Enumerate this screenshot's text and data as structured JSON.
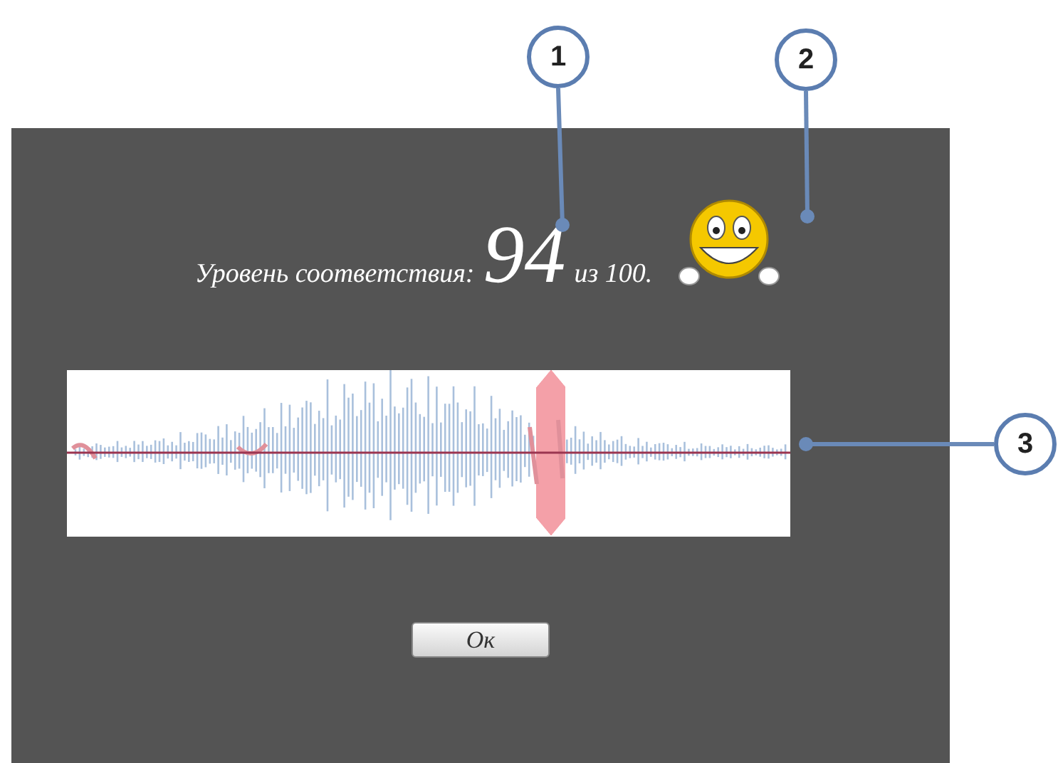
{
  "dialog": {
    "score_label": "Уровень соответствия:",
    "score": "94",
    "score_suffix": "из 100.",
    "button": "Ок"
  },
  "callouts": [
    {
      "label": "1"
    },
    {
      "label": "2"
    },
    {
      "label": "3"
    }
  ]
}
